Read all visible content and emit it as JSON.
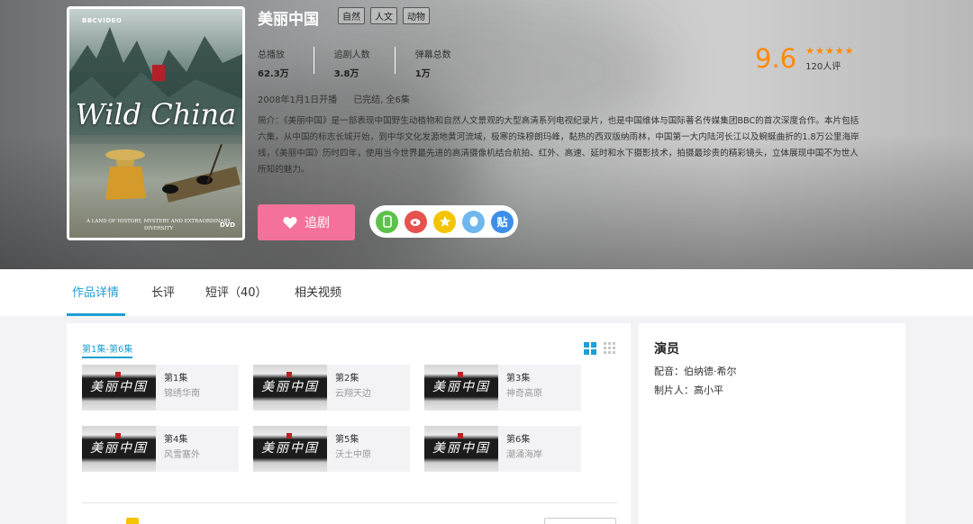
{
  "poster": {
    "brand": "BBCVIDEO",
    "title": "Wild China",
    "tagline": "A LAND OF HISTORY, MYSTERY AND EXTRAORDINARY DIVERSITY",
    "format": "DVD"
  },
  "show": {
    "title": "美丽中国",
    "tags": [
      "自然",
      "人文",
      "动物"
    ],
    "stats": [
      {
        "label": "总播放",
        "value": "62.3万"
      },
      {
        "label": "追剧人数",
        "value": "3.8万"
      },
      {
        "label": "弹幕总数",
        "value": "1万"
      }
    ],
    "premiere": "2008年1月1日开播",
    "status": "已完结, 全6集",
    "description": "简介：《美丽中国》是一部表现中国野生动植物和自然人文景观的大型高清系列电视纪录片，也是中国维体与国际著名传媒集团BBC的首次深度合作。本片包括六集，从中国的标志长城开始，到中华文化发源地黄河流域，极寒的珠穆朗玛峰，黏热的西双版纳雨林，中国第一大内陆河长江以及蜿蜒曲折的1.8万公里海岸线，《美丽中国》历时四年，使用当今世界最先进的高清摄像机结合航拍、红外、高速、延时和水下摄影技术，拍摄最珍贵的精彩镜头，立体展现中国不为世人所知的魅力。",
    "rating": {
      "score": "9.6",
      "stars": 5,
      "count": "120人评"
    },
    "follow_label": "追剧",
    "share": [
      {
        "icon": "wechat-icon",
        "glyph": "▯",
        "color": "#5cc24a"
      },
      {
        "icon": "weibo-icon",
        "glyph": "◉",
        "color": "#e6524e"
      },
      {
        "icon": "qzone-icon",
        "glyph": "★",
        "color": "#f4c400"
      },
      {
        "icon": "qq-icon",
        "glyph": "●",
        "color": "#6fb7ee"
      },
      {
        "icon": "tieba-icon",
        "glyph": "贴",
        "color": "#3d8fe6"
      }
    ]
  },
  "tabs": [
    {
      "label": "作品详情",
      "active": true
    },
    {
      "label": "长评",
      "active": false
    },
    {
      "label": "短评（40）",
      "active": false
    },
    {
      "label": "相关视频",
      "active": false
    }
  ],
  "episodes": {
    "range_label": "第1集-第6集",
    "thumb_text": "美丽中国",
    "list": [
      {
        "num": "第1集",
        "name": "锦绣华南"
      },
      {
        "num": "第2集",
        "name": "云翔天边"
      },
      {
        "num": "第3集",
        "name": "神奇高原"
      },
      {
        "num": "第4集",
        "name": "风雪塞外"
      },
      {
        "num": "第5集",
        "name": "沃土中原"
      },
      {
        "num": "第6集",
        "name": "潮涌海岸"
      }
    ]
  },
  "cast": {
    "heading": "演员",
    "roles": [
      {
        "text": "配音：伯纳德·希尔"
      },
      {
        "text": "制片人：高小平"
      }
    ]
  },
  "colors": {
    "accent": "#1e9fd5",
    "follow": "#f4729a",
    "rating": "#ff8a00"
  }
}
